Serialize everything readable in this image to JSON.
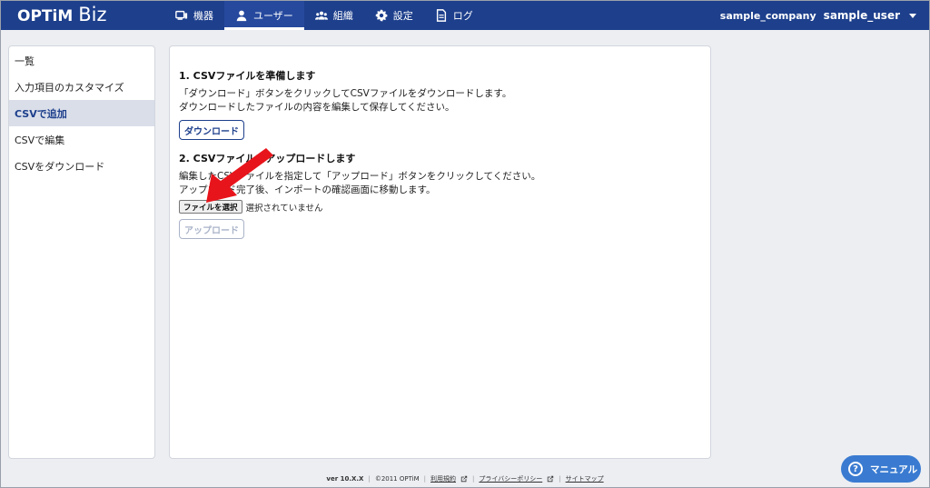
{
  "header": {
    "logo_main": "OPTiM",
    "logo_sub": "Biz",
    "nav": [
      {
        "label": "機器",
        "icon": "device-icon"
      },
      {
        "label": "ユーザー",
        "icon": "user-icon",
        "active": true
      },
      {
        "label": "組織",
        "icon": "organization-icon"
      },
      {
        "label": "設定",
        "icon": "gear-icon"
      },
      {
        "label": "ログ",
        "icon": "document-icon"
      }
    ],
    "company": "sample_company",
    "user": "sample_user"
  },
  "sidebar": {
    "items": [
      {
        "label": "一覧"
      },
      {
        "label": "入力項目のカスタマイズ"
      },
      {
        "label": "CSVで追加",
        "active": true
      },
      {
        "label": "CSVで編集"
      },
      {
        "label": "CSVをダウンロード"
      }
    ]
  },
  "main": {
    "step1": {
      "title": "1. CSVファイルを準備します",
      "line1": "「ダウンロード」ボタンをクリックしてCSVファイルをダウンロードします。",
      "line2": "ダウンロードしたファイルの内容を編集して保存してください。",
      "button": "ダウンロード"
    },
    "step2": {
      "title": "2. CSVファイルをアップロードします",
      "line1": "編集したCSVファイルを指定して「アップロード」ボタンをクリックしてください。",
      "line2": "アップロード完了後、インポートの確認画面に移動します。",
      "file_button": "ファイルを選択",
      "file_status": "選択されていません",
      "upload_button": "アップロード"
    }
  },
  "footer": {
    "version": "ver 10.X.X",
    "copyright": "©2011 OPTiM",
    "terms": "利用規約",
    "privacy": "プライバシーポリシー",
    "sitemap": "サイトマップ"
  },
  "help": {
    "label": "マニュアル"
  },
  "colors": {
    "header": "#1d3f8c",
    "accent": "#3a7bd1",
    "arrow": "#e8141b"
  }
}
